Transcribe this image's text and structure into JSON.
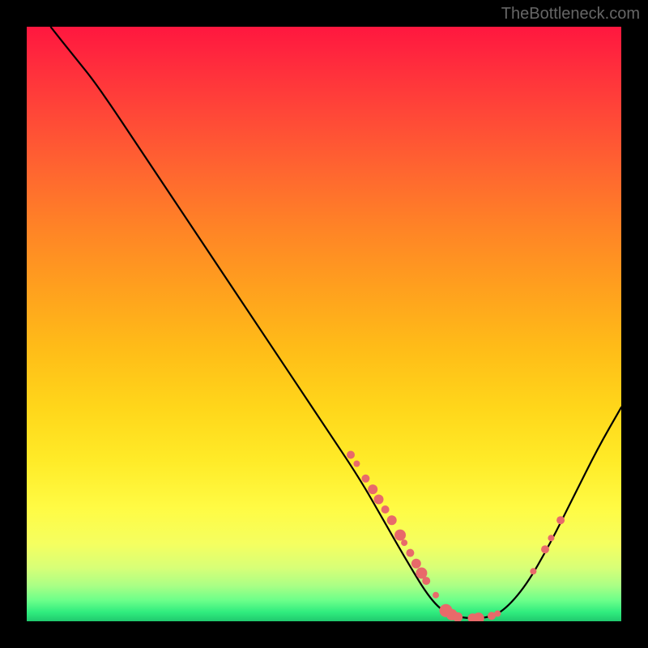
{
  "watermark": "TheBottleneck.com",
  "chart_data": {
    "type": "line",
    "title": "",
    "xlabel": "",
    "ylabel": "",
    "x_range": [
      0,
      100
    ],
    "y_range": [
      0,
      100
    ],
    "curve": [
      {
        "x": 4,
        "y": 100
      },
      {
        "x": 8,
        "y": 95
      },
      {
        "x": 12,
        "y": 90
      },
      {
        "x": 20,
        "y": 78
      },
      {
        "x": 30,
        "y": 63
      },
      {
        "x": 40,
        "y": 48
      },
      {
        "x": 50,
        "y": 33
      },
      {
        "x": 56,
        "y": 24
      },
      {
        "x": 60,
        "y": 17
      },
      {
        "x": 64,
        "y": 10
      },
      {
        "x": 68,
        "y": 3.5
      },
      {
        "x": 71,
        "y": 1
      },
      {
        "x": 74,
        "y": 0.5
      },
      {
        "x": 77,
        "y": 0.5
      },
      {
        "x": 80,
        "y": 1.5
      },
      {
        "x": 84,
        "y": 6
      },
      {
        "x": 88,
        "y": 13
      },
      {
        "x": 92,
        "y": 21
      },
      {
        "x": 96,
        "y": 29
      },
      {
        "x": 100,
        "y": 36
      }
    ],
    "markers": [
      {
        "x": 54.5,
        "y": 28,
        "r": 5
      },
      {
        "x": 55.5,
        "y": 26.5,
        "r": 4
      },
      {
        "x": 57,
        "y": 24,
        "r": 5
      },
      {
        "x": 58.2,
        "y": 22.2,
        "r": 6
      },
      {
        "x": 59.2,
        "y": 20.5,
        "r": 6
      },
      {
        "x": 60.3,
        "y": 18.8,
        "r": 5
      },
      {
        "x": 61.4,
        "y": 17,
        "r": 6
      },
      {
        "x": 62.8,
        "y": 14.5,
        "r": 7
      },
      {
        "x": 63.5,
        "y": 13.2,
        "r": 4
      },
      {
        "x": 64.5,
        "y": 11.5,
        "r": 5
      },
      {
        "x": 65.5,
        "y": 9.7,
        "r": 6
      },
      {
        "x": 66.4,
        "y": 8.1,
        "r": 7
      },
      {
        "x": 67.2,
        "y": 6.8,
        "r": 5
      },
      {
        "x": 68.8,
        "y": 4.4,
        "r": 4
      },
      {
        "x": 70.5,
        "y": 1.8,
        "r": 8
      },
      {
        "x": 71.5,
        "y": 1.1,
        "r": 7
      },
      {
        "x": 72.5,
        "y": 0.7,
        "r": 6
      },
      {
        "x": 75,
        "y": 0.5,
        "r": 6
      },
      {
        "x": 76,
        "y": 0.5,
        "r": 7
      },
      {
        "x": 78.2,
        "y": 0.9,
        "r": 5
      },
      {
        "x": 79.2,
        "y": 1.3,
        "r": 4
      },
      {
        "x": 85.2,
        "y": 8.4,
        "r": 4
      },
      {
        "x": 87.2,
        "y": 12.1,
        "r": 5
      },
      {
        "x": 88.2,
        "y": 14,
        "r": 4
      },
      {
        "x": 89.8,
        "y": 17,
        "r": 5
      }
    ],
    "colors": {
      "curve": "#000000",
      "markers": "#e86a6a",
      "gradient_top": "#ff173f",
      "gradient_bottom": "#20c96e"
    }
  }
}
